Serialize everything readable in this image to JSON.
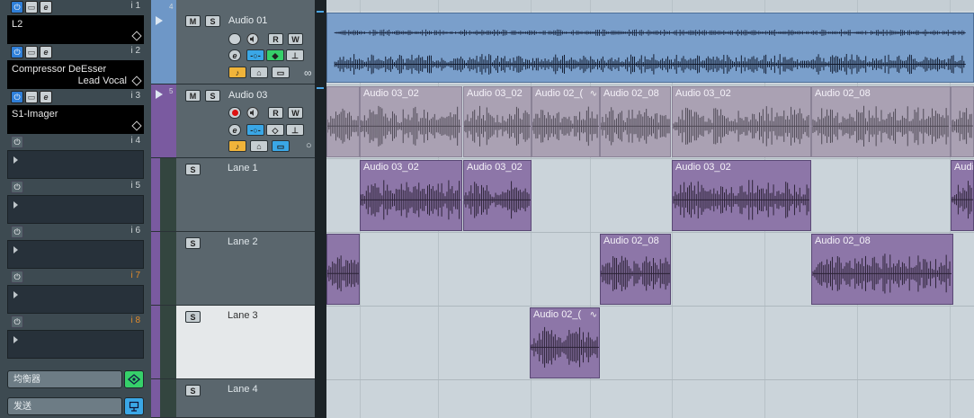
{
  "inspector": {
    "slots": [
      {
        "num": "i 1",
        "name": "L2",
        "preset": "",
        "active": true,
        "orange": false
      },
      {
        "num": "i 2",
        "name": "Compressor DeEsser",
        "preset": "Lead Vocal",
        "active": true,
        "orange": false
      },
      {
        "num": "i 3",
        "name": "S1-Imager",
        "preset": "",
        "active": true,
        "orange": false
      },
      {
        "num": "i 4",
        "name": "",
        "preset": "",
        "active": false,
        "orange": false
      },
      {
        "num": "i 5",
        "name": "",
        "preset": "",
        "active": false,
        "orange": false
      },
      {
        "num": "i 6",
        "name": "",
        "preset": "",
        "active": false,
        "orange": false
      },
      {
        "num": "i 7",
        "name": "",
        "preset": "",
        "active": false,
        "orange": true
      },
      {
        "num": "i 8",
        "name": "",
        "preset": "",
        "active": false,
        "orange": true
      }
    ],
    "eq_label": "均衡器",
    "send_label": "发送"
  },
  "tracks": [
    {
      "num": "4",
      "name": "Audio 01",
      "m": "M",
      "s": "S",
      "r": "R",
      "w": "W"
    },
    {
      "num": "5",
      "name": "Audio 03",
      "m": "M",
      "s": "S",
      "r": "R",
      "w": "W"
    }
  ],
  "lanes": [
    {
      "name": "Lane 1",
      "s": "S"
    },
    {
      "name": "Lane 2",
      "s": "S"
    },
    {
      "name": "Lane 3",
      "s": "S"
    },
    {
      "name": "Lane 4",
      "s": "S"
    }
  ],
  "events": {
    "comp_row": [
      {
        "label": ""
      },
      {
        "label": "Audio 03_02"
      },
      {
        "label": "Audio 03_02"
      },
      {
        "label": "Audio 02_("
      },
      {
        "label": "Audio 02_08"
      },
      {
        "label": "Audio 03_02"
      },
      {
        "label": "Audio 02_08"
      },
      {
        "label": ""
      }
    ],
    "lane1": [
      {
        "label": "Audio 03_02"
      },
      {
        "label": "Audio 03_02"
      },
      {
        "label": "Audio 03_02"
      },
      {
        "label": "Audi"
      }
    ],
    "lane2": [
      {
        "label": ""
      },
      {
        "label": "Audio 02_08"
      },
      {
        "label": "Audio 02_08"
      }
    ],
    "lane3": [
      {
        "label": "Audio 02_("
      }
    ]
  },
  "colors": {
    "track_blue": "#6e97c7",
    "lane_purple": "#8d76a8",
    "accent_blue": "#3aa7e6",
    "accent_green": "#36d06a"
  }
}
